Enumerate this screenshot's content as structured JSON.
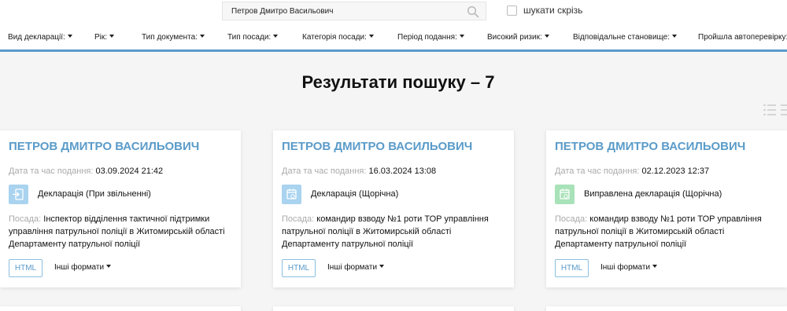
{
  "search": {
    "value": "Петров Дмитро Васильович",
    "search_all_label": "шукати скрізь"
  },
  "filters": [
    "Вид декларації:",
    "Рік:",
    "Тип документа:",
    "Тип посади:",
    "Категорія посади:",
    "Період подання:",
    "Високий ризик:",
    "Відповідальне становище:",
    "Пройшла автоперевірку:"
  ],
  "results_title": "Результати пошуку – 7",
  "labels": {
    "date": "Дата та час подання:",
    "position": "Посада:",
    "html_button": "HTML",
    "other_formats": "Інші формати"
  },
  "colors": {
    "accent": "#5a9bc9",
    "icon_blue": "#a9d3ef",
    "icon_green": "#a8e2b8"
  },
  "cards": [
    {
      "name": "ПЕТРОВ ДМИТРО ВАСИЛЬОВИЧ",
      "date": "03.09.2024 21:42",
      "doc_type": "Декларація (При звільненні)",
      "icon": "exit-document-icon",
      "position": "Інспектор відділення тактичної підтримки управління патрульної поліції в Житомирській області Департаменту патрульної поліції"
    },
    {
      "name": "ПЕТРОВ ДМИТРО ВАСИЛЬОВИЧ",
      "date": "16.03.2024 13:08",
      "doc_type": "Декларація (Щорічна)",
      "icon": "annual-calendar-icon",
      "position": "командир взводу №1 роти ТОР управління патрульної поліції в Житомирській області Департаменту патрульної поліції"
    },
    {
      "name": "ПЕТРОВ ДМИТРО ВАСИЛЬОВИЧ",
      "date": "02.12.2023 12:37",
      "doc_type": "Виправлена декларація (Щорічна)",
      "icon": "corrected-calendar-icon",
      "position": "командир взводу №1 роти ТОР управління патрульної поліції в Житомирській області Департаменту патрульної поліції"
    }
  ]
}
